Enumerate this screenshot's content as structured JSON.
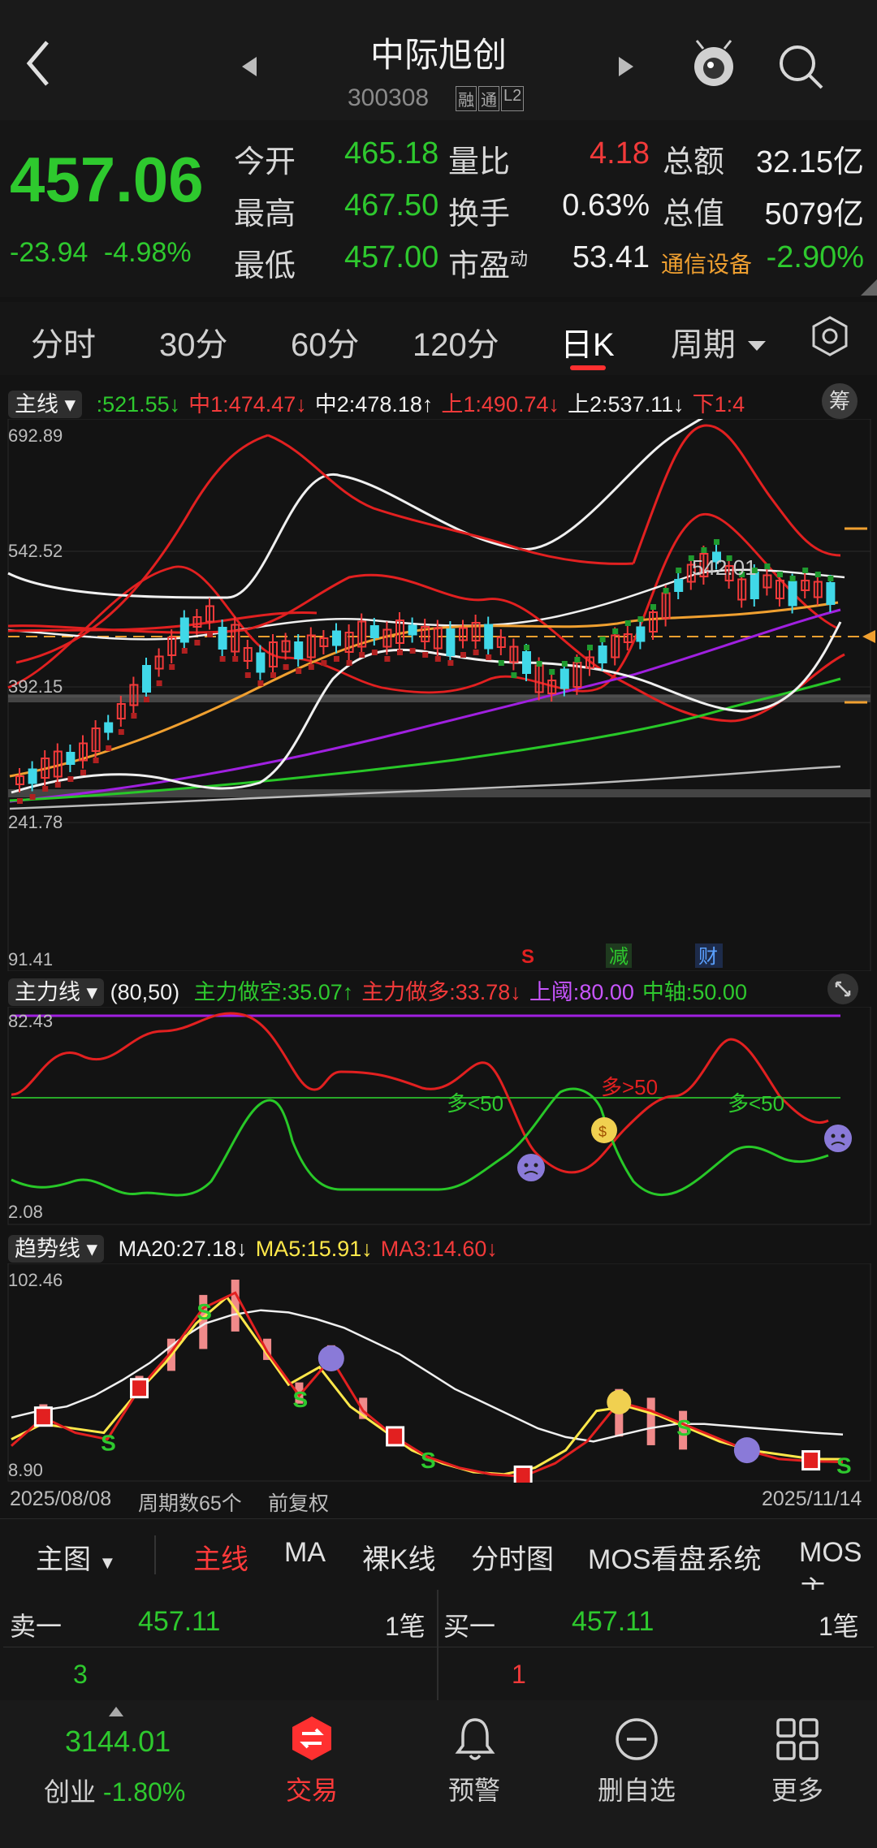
{
  "header": {
    "title": "中际旭创",
    "code": "300308",
    "badges": [
      "融",
      "通",
      "L2"
    ]
  },
  "quote": {
    "price": "457.06",
    "change": "-23.94",
    "change_pct": "-4.98%",
    "open_label": "今开",
    "open": "465.18",
    "high_label": "最高",
    "high": "467.50",
    "low_label": "最低",
    "low": "457.00",
    "vol_ratio_label": "量比",
    "vol_ratio": "4.18",
    "turnover_label": "换手",
    "turnover": "0.63%",
    "pe_label": "市盈",
    "pe_sup": "动",
    "pe": "53.41",
    "amount_label": "总额",
    "amount": "32.15亿",
    "mcap_label": "总值",
    "mcap": "5079亿",
    "sector": "通信设备",
    "sector_change": "-2.90%"
  },
  "tabs": [
    "分时",
    "30分",
    "60分",
    "120分",
    "日K",
    "周期"
  ],
  "active_tab": "日K",
  "main_chart": {
    "indicator": "主线",
    "legend": [
      {
        "text": ":521.55",
        "arrow": "↓",
        "color": "#2ec92e"
      },
      {
        "text": "中1:474.47",
        "arrow": "↓",
        "color": "#f23a3a"
      },
      {
        "text": "中2:478.18",
        "arrow": "↑",
        "color": "#f0f0f0"
      },
      {
        "text": "上1:490.74",
        "arrow": "↓",
        "color": "#f23a3a"
      },
      {
        "text": "上2:537.11",
        "arrow": "↓",
        "color": "#f0f0f0"
      },
      {
        "text": "下1:4",
        "arrow": "",
        "color": "#f23a3a"
      }
    ],
    "chip_label": "筹",
    "y_labels": [
      "692.89",
      "542.52",
      "392.15",
      "241.78",
      "91.41"
    ],
    "peak_label": "542.01",
    "event_labels": [
      "S",
      "减",
      "财"
    ]
  },
  "force_chart": {
    "indicator": "主力线",
    "params": "(80,50)",
    "legend": [
      {
        "text": "主力做空:35.07",
        "arrow": "↑",
        "color": "#2ec92e"
      },
      {
        "text": "主力做多:33.78",
        "arrow": "↓",
        "color": "#f23a3a"
      },
      {
        "text": "上阈:80.00",
        "arrow": "",
        "color": "#c855ff"
      },
      {
        "text": "中轴:50.00",
        "arrow": "",
        "color": "#2ec92e"
      }
    ],
    "y_top": "82.43",
    "y_bottom": "2.08",
    "annotations": [
      "多<50",
      "多>50",
      "多<50"
    ]
  },
  "trend_chart": {
    "indicator": "趋势线",
    "legend": [
      {
        "text": "MA20:27.18",
        "arrow": "↓",
        "color": "#f0f0f0"
      },
      {
        "text": "MA5:15.91",
        "arrow": "↓",
        "color": "#ffe84a"
      },
      {
        "text": "MA3:14.60",
        "arrow": "↓",
        "color": "#f23a3a"
      }
    ],
    "y_top": "102.46",
    "y_bottom": "8.90",
    "ma20": [
      35,
      38,
      40,
      45,
      52,
      60,
      70,
      78,
      82,
      84,
      83,
      80,
      76,
      70,
      64,
      56,
      48,
      42,
      36,
      30,
      26,
      24,
      27,
      30,
      32,
      32,
      31,
      30,
      29,
      28,
      27.18
    ],
    "ma5": [
      25,
      32,
      30,
      28,
      45,
      60,
      78,
      90,
      70,
      50,
      58,
      40,
      30,
      20,
      14,
      10,
      9,
      12,
      20,
      38,
      40,
      36,
      30,
      24,
      20,
      18,
      16,
      15.91
    ],
    "ma3": [
      22,
      35,
      28,
      25,
      48,
      65,
      85,
      92,
      65,
      45,
      62,
      38,
      26,
      17,
      12,
      9,
      8,
      14,
      24,
      42,
      38,
      32,
      26,
      20,
      16,
      15,
      14.6
    ]
  },
  "x_axis": {
    "start": "2025/08/08",
    "count": "周期数65个",
    "adjust": "前复权",
    "end": "2025/11/14"
  },
  "sub_tabs": [
    "主图",
    "主线",
    "MA",
    "裸K线",
    "分时图",
    "MOS看盘系统",
    "MOS主"
  ],
  "active_sub": "主线",
  "orders": {
    "sell_label": "卖一",
    "sell_price": "457.11",
    "sell_count": "1笔",
    "sell_vol": "3",
    "buy_label": "买一",
    "buy_price": "457.11",
    "buy_count": "1笔",
    "buy_vol": "1"
  },
  "index": {
    "value": "3144.01",
    "name": "创业",
    "change": "-1.80%"
  },
  "nav": [
    "交易",
    "预警",
    "删自选",
    "更多"
  ],
  "colors": {
    "up": "#f23a3a",
    "down": "#2ec92e",
    "accent": "#ff3030",
    "bg": "#131313"
  }
}
